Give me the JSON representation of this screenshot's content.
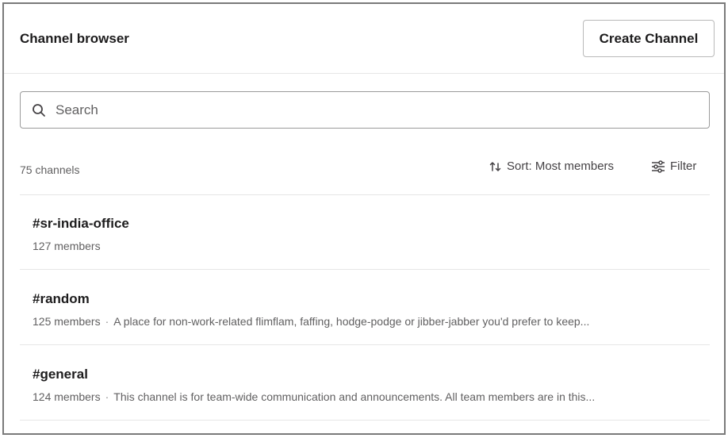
{
  "header": {
    "title": "Channel browser",
    "create_button_label": "Create Channel"
  },
  "search": {
    "placeholder": "Search",
    "value": ""
  },
  "toolbar": {
    "channel_count": "75 channels",
    "sort_label": "Sort: Most members",
    "filter_label": "Filter"
  },
  "channels": [
    {
      "name": "#sr-india-office",
      "members": "127 members",
      "description": ""
    },
    {
      "name": "#random",
      "members": "125 members",
      "description": "A place for non-work-related flimflam, faffing, hodge-podge or jibber-jabber you'd prefer to keep..."
    },
    {
      "name": "#general",
      "members": "124 members",
      "description": "This channel is for team-wide communication and announcements. All team members are in this..."
    }
  ],
  "icons": {
    "search": "search-icon",
    "sort": "sort-arrows-icon",
    "filter": "sliders-icon"
  },
  "colors": {
    "text_primary": "#1d1c1d",
    "text_secondary": "#616061",
    "border": "#e6e6e6"
  }
}
